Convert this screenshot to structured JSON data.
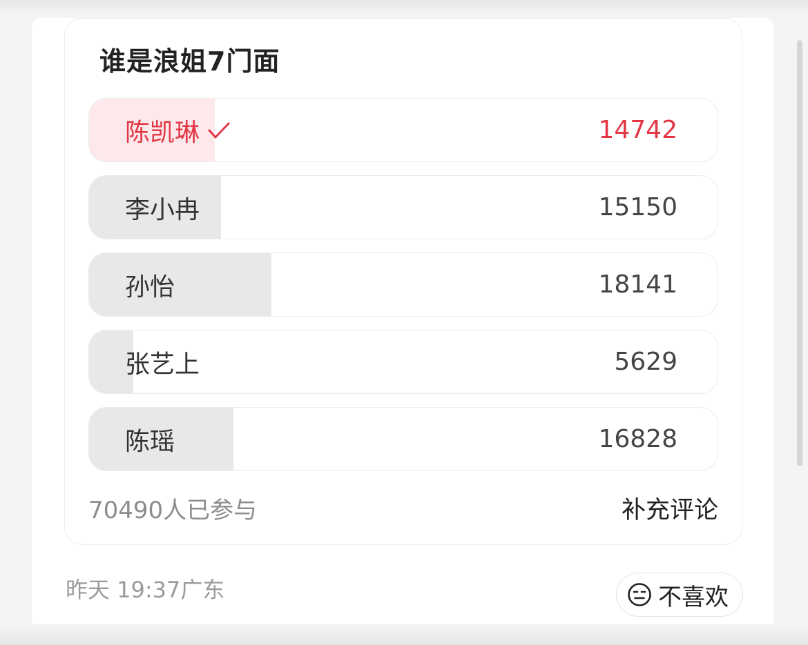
{
  "poll": {
    "title": "谁是浪姐7门面",
    "options": [
      {
        "label": "陈凯琳",
        "votes": "14742",
        "selected": true,
        "fill_fraction": 0.2
      },
      {
        "label": "李小冉",
        "votes": "15150",
        "selected": false,
        "fill_fraction": 0.21
      },
      {
        "label": "孙怡",
        "votes": "18141",
        "selected": false,
        "fill_fraction": 0.29
      },
      {
        "label": "张艺上",
        "votes": "5629",
        "selected": false,
        "fill_fraction": 0.07
      },
      {
        "label": "陈瑶",
        "votes": "16828",
        "selected": false,
        "fill_fraction": 0.23
      }
    ],
    "participants_text": "70490人已参与",
    "add_comment_label": "补充评论"
  },
  "meta": {
    "timestamp_location": "昨天 19:37广东"
  },
  "actions": {
    "dislike_label": "不喜欢",
    "dislike_icon": "neutral-face-icon"
  },
  "colors": {
    "accent": "#e23644",
    "selected_fill": "#fde9ec",
    "option_fill": "#e8e8e8"
  },
  "icons": {
    "selected_mark": "check-icon"
  }
}
